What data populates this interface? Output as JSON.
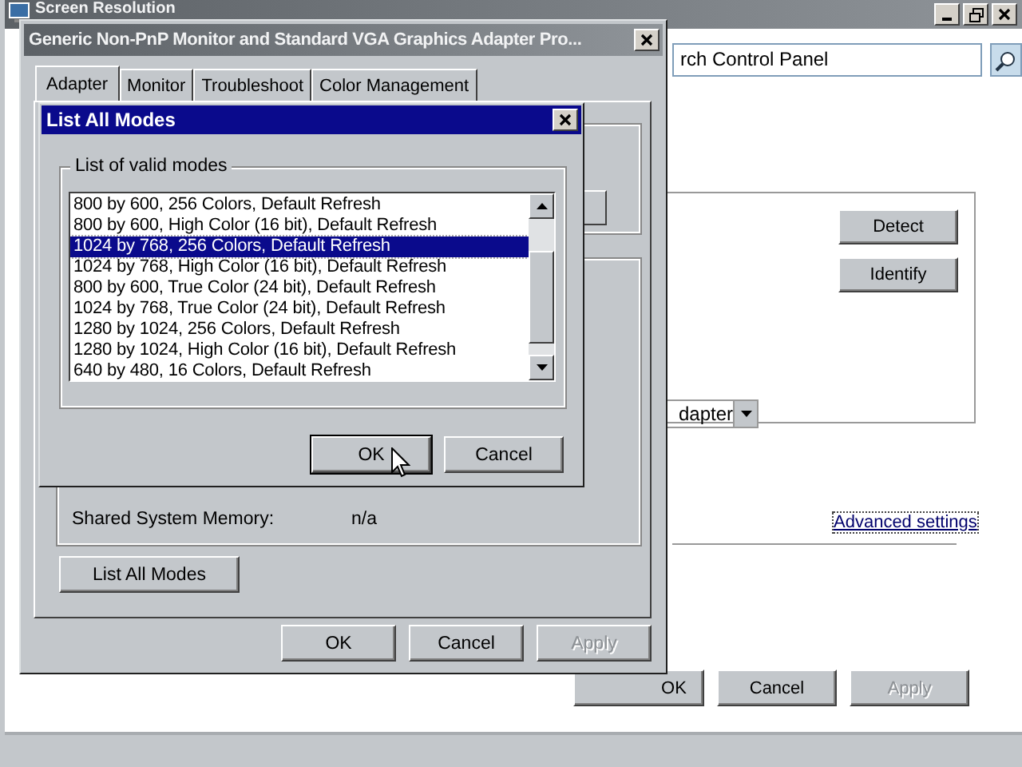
{
  "background_window": {
    "title": "Screen Resolution",
    "search": {
      "value": "rch Control Panel"
    },
    "side_buttons": [
      {
        "label": "Detect"
      },
      {
        "label": "Identify"
      }
    ],
    "dropdown": {
      "value": "dapter"
    },
    "link": "Advanced settings",
    "buttons": [
      {
        "label": "OK",
        "disabled": false
      },
      {
        "label": "Cancel",
        "disabled": false
      },
      {
        "label": "Apply",
        "disabled": true
      }
    ]
  },
  "properties_dialog": {
    "title": "Generic Non-PnP Monitor and Standard VGA Graphics Adapter Pro...",
    "tabs": [
      {
        "label": "Adapter",
        "selected": true
      },
      {
        "label": "Monitor",
        "selected": false
      },
      {
        "label": "Troubleshoot",
        "selected": false
      },
      {
        "label": "Color Management",
        "selected": false
      }
    ],
    "memory_label": "Shared System Memory:",
    "memory_value": "n/a",
    "list_all_modes_button": "List All Modes",
    "buttons": [
      {
        "label": "OK",
        "disabled": false
      },
      {
        "label": "Cancel",
        "disabled": false
      },
      {
        "label": "Apply",
        "disabled": true
      }
    ]
  },
  "modes_dialog": {
    "title": "List All Modes",
    "group_label": "List of valid modes",
    "modes": [
      {
        "label": "800 by 600, 256 Colors, Default Refresh",
        "selected": false
      },
      {
        "label": "800 by 600, High Color (16 bit), Default Refresh",
        "selected": false
      },
      {
        "label": "1024 by 768, 256 Colors, Default Refresh",
        "selected": true
      },
      {
        "label": "1024 by 768, High Color (16 bit), Default Refresh",
        "selected": false
      },
      {
        "label": "800 by 600, True Color (24 bit), Default Refresh",
        "selected": false
      },
      {
        "label": "1024 by 768, True Color (24 bit), Default Refresh",
        "selected": false
      },
      {
        "label": "1280 by 1024, 256 Colors, Default Refresh",
        "selected": false
      },
      {
        "label": "1280 by 1024, High Color (16 bit), Default Refresh",
        "selected": false
      },
      {
        "label": "640 by 480, 16 Colors, Default Refresh",
        "selected": false
      }
    ],
    "buttons": [
      {
        "label": "OK",
        "focused": true
      },
      {
        "label": "Cancel",
        "focused": false
      }
    ]
  }
}
